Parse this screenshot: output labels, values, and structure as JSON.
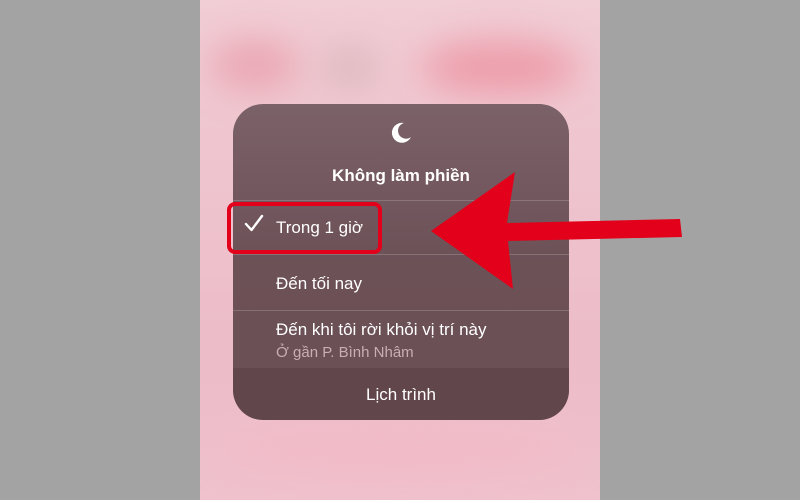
{
  "dnd_menu": {
    "icon": "moon-icon",
    "title": "Không làm phiền",
    "options": [
      {
        "label": "Trong 1 giờ",
        "selected": true
      },
      {
        "label": "Đến tối nay",
        "selected": false
      },
      {
        "label": "Đến khi tôi rời khỏi vị trí này",
        "sublabel": "Ở gần P. Bình Nhâm",
        "selected": false
      }
    ],
    "schedule_label": "Lịch trình"
  },
  "annotation": {
    "highlight_color": "#e2001a",
    "arrow_icon": "arrow-left-icon"
  },
  "colors": {
    "panel": "#6c5157",
    "background_side": "#a3a3a3",
    "background_phone": "#eec3cd",
    "sublabel": "#c9aeb4"
  }
}
